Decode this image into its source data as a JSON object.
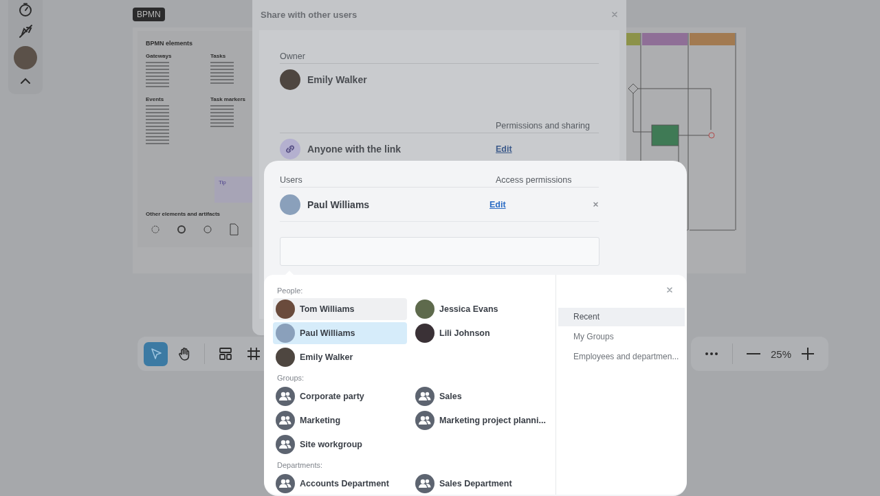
{
  "canvas": {
    "board_label": "BPMN",
    "library": {
      "title": "BPMN elements",
      "sections": [
        {
          "title": "Gateways"
        },
        {
          "title": "Tasks"
        },
        {
          "title": "Events"
        },
        {
          "title": "Task markers"
        }
      ],
      "tip_title": "Tip",
      "artifacts_title": "Other elements and artifacts"
    }
  },
  "bottom_toolbar": {
    "tools": [
      {
        "kind": "select",
        "selected": true
      },
      {
        "kind": "hand",
        "selected": false
      },
      {
        "kind": "layout",
        "selected": false
      },
      {
        "kind": "frame",
        "selected": false
      }
    ],
    "zoom": "25%"
  },
  "dialog": {
    "title": "Share with other users",
    "owner_label": "Owner",
    "owner_name": "Emily Walker",
    "sharing_header": "Permissions and sharing",
    "link_label": "Anyone with the link",
    "link_action": "Edit",
    "users": {
      "columns": [
        "Users",
        "Access permissions"
      ],
      "rows": [
        {
          "name": "Paul Williams",
          "action": "Edit"
        }
      ]
    }
  },
  "picker": {
    "sections": [
      {
        "heading": "People:",
        "items": [
          {
            "kind": "person",
            "name": "Tom Williams",
            "selected": false,
            "hovered": true
          },
          {
            "kind": "person",
            "name": "Jessica Evans",
            "selected": false,
            "hovered": false
          },
          {
            "kind": "person",
            "name": "Paul Williams",
            "selected": true,
            "hovered": false
          },
          {
            "kind": "person",
            "name": "Lili Johnson",
            "selected": false,
            "hovered": false
          },
          {
            "kind": "person",
            "name": "Emily Walker",
            "selected": false,
            "hovered": false
          }
        ]
      },
      {
        "heading": "Groups:",
        "items": [
          {
            "kind": "group",
            "name": "Corporate party",
            "selected": false,
            "hovered": false
          },
          {
            "kind": "group",
            "name": "Sales",
            "selected": false,
            "hovered": false
          },
          {
            "kind": "group",
            "name": "Marketing",
            "selected": false,
            "hovered": false
          },
          {
            "kind": "group",
            "name": "Marketing project planni...",
            "selected": false,
            "hovered": false
          },
          {
            "kind": "group",
            "name": "Site workgroup",
            "selected": false,
            "hovered": false
          }
        ]
      },
      {
        "heading": "Departments:",
        "items": [
          {
            "kind": "group",
            "name": "Accounts Department",
            "selected": false,
            "hovered": false
          },
          {
            "kind": "group",
            "name": "Sales Department",
            "selected": false,
            "hovered": false
          }
        ]
      }
    ],
    "menu": [
      {
        "label": "Recent",
        "selected": true
      },
      {
        "label": "My Groups",
        "selected": false
      },
      {
        "label": "Employees and departmen...",
        "selected": false
      }
    ]
  }
}
